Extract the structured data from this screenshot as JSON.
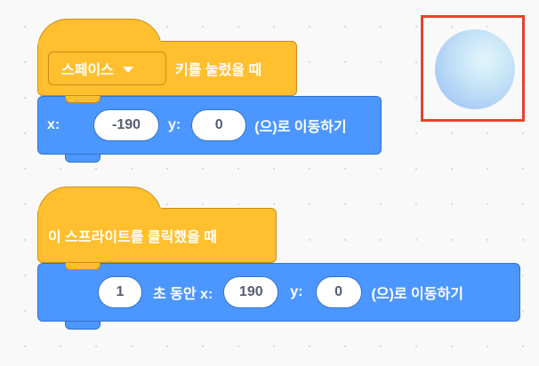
{
  "scripts": [
    {
      "event": {
        "key_dropdown": "스페이스",
        "text": "키를 눌렀을 때"
      },
      "motion": {
        "x_label": "x:",
        "x_value": "-190",
        "y_label": "y:",
        "y_value": "0",
        "suffix": "(으)로 이동하기"
      }
    },
    {
      "event": {
        "text": "이 스프라이트를 클릭했을 때"
      },
      "motion": {
        "secs_value": "1",
        "secs_label": "초 동안 x:",
        "x_value": "190",
        "y_label": "y:",
        "y_value": "0",
        "suffix": "(으)로 이동하기"
      }
    }
  ],
  "sprite": {
    "icon": "ball-sprite",
    "selected_outline_color": "#e5432e"
  },
  "colors": {
    "events": "#ffbf2e",
    "motion": "#4c97ff"
  }
}
